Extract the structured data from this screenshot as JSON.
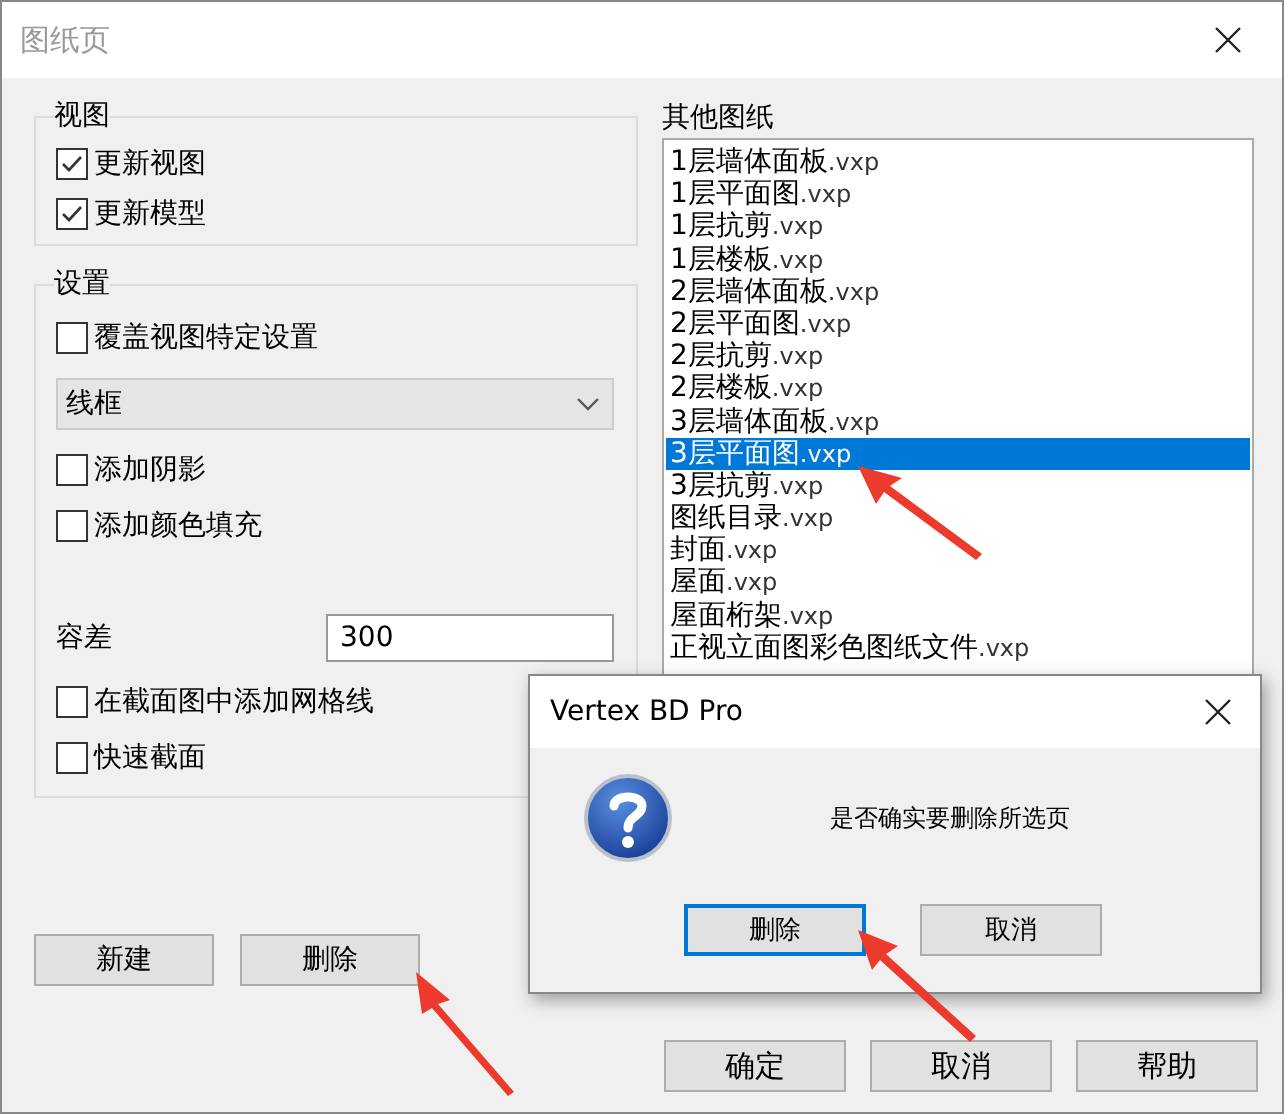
{
  "window": {
    "title": "图纸页"
  },
  "view_group": {
    "title": "视图",
    "options": [
      {
        "label": "更新视图",
        "checked": true
      },
      {
        "label": "更新模型",
        "checked": true
      }
    ]
  },
  "settings_group": {
    "title": "设置",
    "items": [
      {
        "kind": "checkbox",
        "label": "覆盖视图特定设置",
        "checked": false
      },
      {
        "kind": "dropdown",
        "value": "线框"
      },
      {
        "kind": "checkbox",
        "label": "添加阴影",
        "checked": false
      },
      {
        "kind": "checkbox",
        "label": "添加颜色填充",
        "checked": false
      },
      {
        "kind": "field",
        "label": "容差",
        "value": "300"
      },
      {
        "kind": "checkbox",
        "label": "在截面图中添加网格线",
        "checked": false
      },
      {
        "kind": "checkbox",
        "label": "快速截面",
        "checked": false
      }
    ]
  },
  "left_buttons": [
    "新建",
    "删除"
  ],
  "drawings": {
    "title": "其他图纸",
    "items": [
      {
        "name": "1层墙体面板",
        "ext": ".vxp",
        "selected": false
      },
      {
        "name": "1层平面图",
        "ext": ".vxp",
        "selected": false
      },
      {
        "name": "1层抗剪",
        "ext": ".vxp",
        "selected": false
      },
      {
        "name": "1层楼板",
        "ext": ".vxp",
        "selected": false
      },
      {
        "name": "2层墙体面板",
        "ext": ".vxp",
        "selected": false
      },
      {
        "name": "2层平面图",
        "ext": ".vxp",
        "selected": false
      },
      {
        "name": "2层抗剪",
        "ext": ".vxp",
        "selected": false
      },
      {
        "name": "2层楼板",
        "ext": ".vxp",
        "selected": false
      },
      {
        "name": "3层墙体面板",
        "ext": ".vxp",
        "selected": false
      },
      {
        "name": "3层平面图",
        "ext": ".vxp",
        "selected": true
      },
      {
        "name": "3层抗剪",
        "ext": ".vxp",
        "selected": false
      },
      {
        "name": "图纸目录",
        "ext": ".vxp",
        "selected": false
      },
      {
        "name": "封面",
        "ext": ".vxp",
        "selected": false
      },
      {
        "name": "屋面",
        "ext": ".vxp",
        "selected": false
      },
      {
        "name": "屋面桁架",
        "ext": ".vxp",
        "selected": false
      },
      {
        "name": "正视立面图彩色图纸文件",
        "ext": ".vxp",
        "selected": false
      }
    ]
  },
  "buttons": [
    "确定",
    "取消",
    "帮助"
  ],
  "dialog": {
    "title": "Vertex BD Pro",
    "message": "是否确实要删除所选页",
    "buttons": [
      {
        "label": "删除",
        "default": true
      },
      {
        "label": "取消",
        "default": false
      }
    ]
  }
}
